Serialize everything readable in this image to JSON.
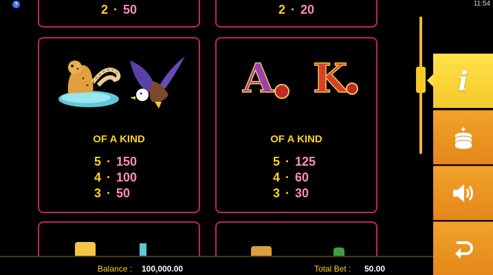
{
  "status": {
    "time": "11:54"
  },
  "paytable": {
    "top_left": {
      "count": "2",
      "amount": "50"
    },
    "top_right": {
      "count": "2",
      "amount": "20"
    },
    "card_left": {
      "kind_label": "OF A KIND",
      "pays": [
        {
          "count": "5",
          "amount": "150"
        },
        {
          "count": "4",
          "amount": "100"
        },
        {
          "count": "3",
          "amount": "50"
        }
      ],
      "symbols": [
        "jaguar-symbol",
        "eagle-symbol"
      ]
    },
    "card_right": {
      "kind_label": "OF A KIND",
      "letters": [
        "A",
        "K"
      ],
      "pays": [
        {
          "count": "5",
          "amount": "125"
        },
        {
          "count": "4",
          "amount": "60"
        },
        {
          "count": "3",
          "amount": "30"
        }
      ]
    }
  },
  "side_buttons": [
    "info-icon",
    "coins-icon",
    "speaker-icon",
    "back-arrow-icon"
  ],
  "footer": {
    "balance_label": "Balance :",
    "balance_value": "100,000.00",
    "total_bet_label": "Total Bet :",
    "total_bet_value": "50.00"
  },
  "colors": {
    "accent": "#f5c92a",
    "button_orange": "#e5861a",
    "card_border": "#c2275a",
    "count_yellow": "#ffd21a",
    "amount_pink": "#ff8cc0"
  }
}
